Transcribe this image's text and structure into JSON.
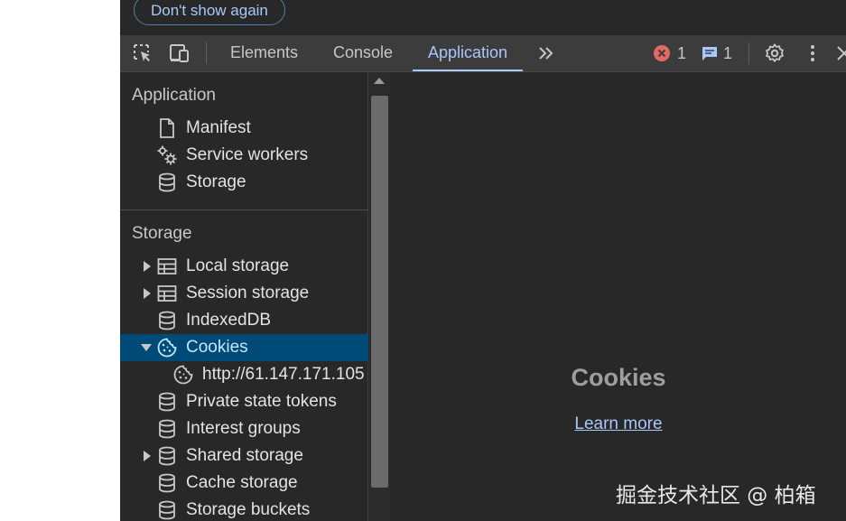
{
  "banner": {
    "dont_show_label": "Don't show again"
  },
  "toolbar": {
    "tabs": [
      {
        "label": "Elements",
        "active": false
      },
      {
        "label": "Console",
        "active": false
      },
      {
        "label": "Application",
        "active": true
      }
    ],
    "errors_count": "1",
    "messages_count": "1",
    "icons": [
      "inspect-element-icon",
      "device-toolbar-icon",
      "more-tabs-chevron-icon",
      "error-icon",
      "message-icon",
      "settings-gear-icon",
      "kebab-menu-icon",
      "close-icon"
    ]
  },
  "sidebar": {
    "application_section": {
      "title": "Application",
      "items": [
        {
          "label": "Manifest",
          "icon": "file-icon"
        },
        {
          "label": "Service workers",
          "icon": "gears-icon"
        },
        {
          "label": "Storage",
          "icon": "database-icon"
        }
      ]
    },
    "storage_section": {
      "title": "Storage",
      "items": [
        {
          "label": "Local storage",
          "icon": "table-icon",
          "expander": "collapsed"
        },
        {
          "label": "Session storage",
          "icon": "table-icon",
          "expander": "collapsed"
        },
        {
          "label": "IndexedDB",
          "icon": "database-icon",
          "expander": "none"
        },
        {
          "label": "Cookies",
          "icon": "cookie-icon",
          "expander": "expanded",
          "selected": true
        },
        {
          "label": "http://61.147.171.105",
          "icon": "cookie-icon",
          "expander": "none",
          "child": true
        },
        {
          "label": "Private state tokens",
          "icon": "database-icon",
          "expander": "none"
        },
        {
          "label": "Interest groups",
          "icon": "database-icon",
          "expander": "none"
        },
        {
          "label": "Shared storage",
          "icon": "database-icon",
          "expander": "collapsed"
        },
        {
          "label": "Cache storage",
          "icon": "database-icon",
          "expander": "none"
        },
        {
          "label": "Storage buckets",
          "icon": "database-icon",
          "expander": "none"
        }
      ]
    }
  },
  "main": {
    "empty_title": "Cookies",
    "learn_more_label": "Learn more"
  },
  "watermark": "掘金技术社区 @ 柏箱",
  "colors": {
    "accent": "#a8c7fa",
    "selected_row": "#004a77",
    "error_red": "#e46962",
    "panel_bg": "#282828",
    "toolbar_bg": "#3c3c3c"
  }
}
